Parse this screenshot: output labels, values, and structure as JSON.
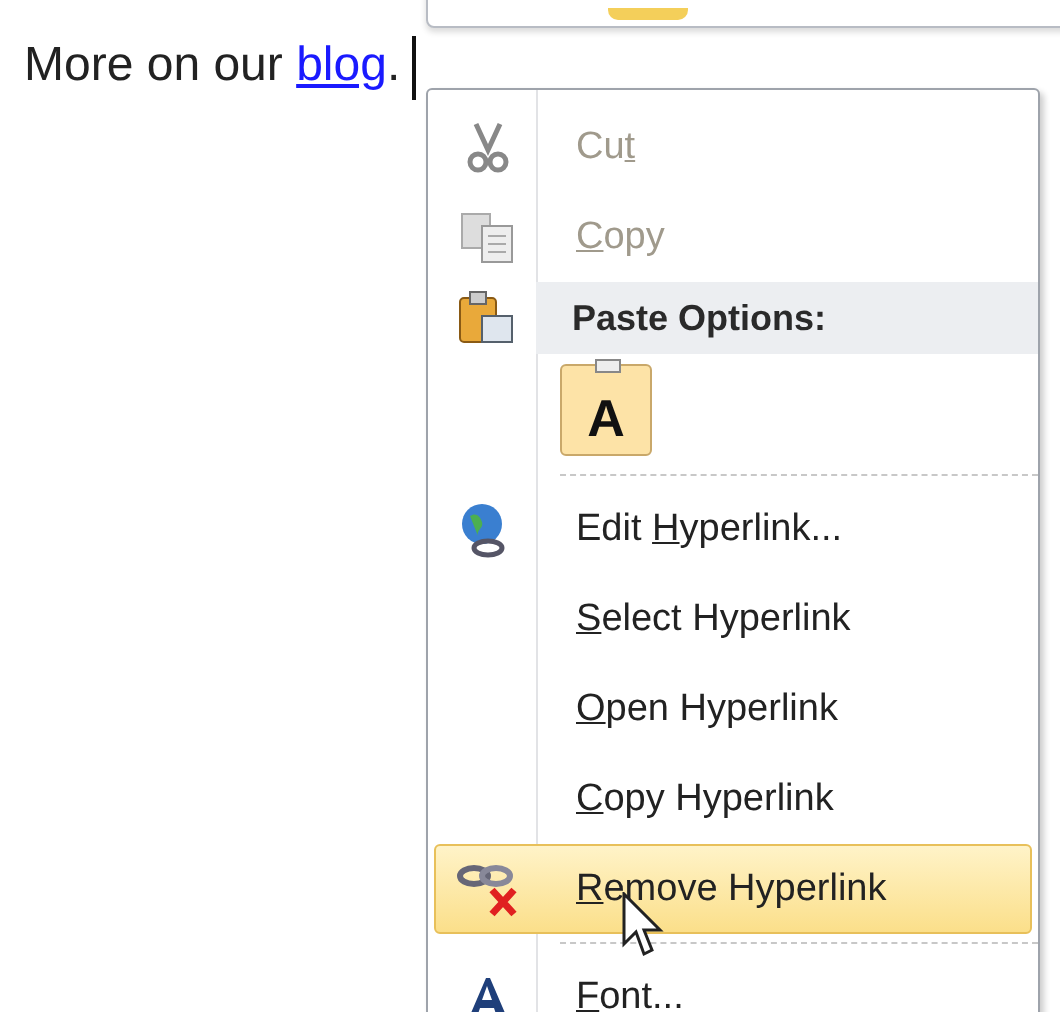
{
  "document": {
    "text_before": "More on our ",
    "link": "blog",
    "text_after": "."
  },
  "context_menu": {
    "items": [
      {
        "kind": "item",
        "label": [
          {
            "text": "Cu",
            "underline": false
          },
          {
            "text": "t",
            "underline": true
          }
        ],
        "disabled": true,
        "selected": false
      },
      {
        "kind": "item",
        "label": [
          {
            "text": "C",
            "underline": true
          },
          {
            "text": "opy",
            "underline": false
          }
        ],
        "disabled": true,
        "selected": false
      },
      {
        "kind": "header",
        "label": "Paste Options:"
      },
      {
        "kind": "paste_options",
        "buttons": [
          {
            "label": "A"
          }
        ]
      },
      {
        "kind": "separator"
      },
      {
        "kind": "item",
        "label": [
          {
            "text": "Edit ",
            "underline": false
          },
          {
            "text": "H",
            "underline": true
          },
          {
            "text": "yperlink...",
            "underline": false
          }
        ],
        "disabled": false,
        "selected": false
      },
      {
        "kind": "item",
        "label": [
          {
            "text": "S",
            "underline": true
          },
          {
            "text": "elect Hyperlink",
            "underline": false
          }
        ],
        "disabled": false,
        "selected": false
      },
      {
        "kind": "item",
        "label": [
          {
            "text": "O",
            "underline": true
          },
          {
            "text": "pen Hyperlink",
            "underline": false
          }
        ],
        "disabled": false,
        "selected": false
      },
      {
        "kind": "item",
        "label": [
          {
            "text": "C",
            "underline": true
          },
          {
            "text": "opy Hyperlink",
            "underline": false
          }
        ],
        "disabled": false,
        "selected": false
      },
      {
        "kind": "item",
        "label": [
          {
            "text": "R",
            "underline": true
          },
          {
            "text": "emove Hyperlink",
            "underline": false
          }
        ],
        "disabled": false,
        "selected": true
      },
      {
        "kind": "separator"
      },
      {
        "kind": "item",
        "label": [
          {
            "text": "F",
            "underline": true
          },
          {
            "text": "ont...",
            "underline": false
          }
        ],
        "disabled": false,
        "selected": false
      }
    ]
  }
}
